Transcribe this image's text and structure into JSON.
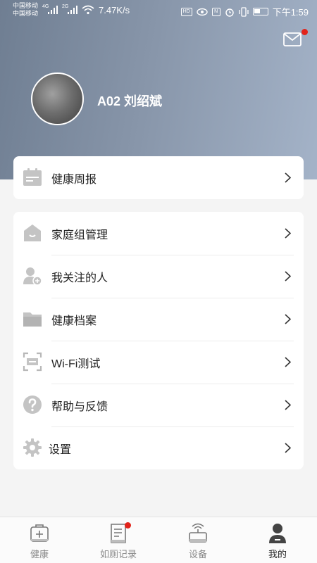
{
  "status_bar": {
    "carrier_1": "中国移动",
    "carrier_2": "中国移动",
    "net_1": "4G",
    "net_2": "2G",
    "speed": "7.47K/s",
    "hd_badge": "HD",
    "time": "下午1:59"
  },
  "profile": {
    "name": "A02 刘绍斌",
    "mail_icon": "mail-icon",
    "has_unread_mail": true
  },
  "weekly_card": {
    "items": [
      {
        "label": "健康周报",
        "icon": "report-icon"
      }
    ]
  },
  "menu": {
    "items": [
      {
        "label": "家庭组管理",
        "icon": "home-icon"
      },
      {
        "label": "我关注的人",
        "icon": "add-user-icon"
      },
      {
        "label": "健康档案",
        "icon": "folder-icon"
      },
      {
        "label": "Wi-Fi测试",
        "icon": "scan-icon"
      },
      {
        "label": "帮助与反馈",
        "icon": "help-icon"
      },
      {
        "label": "设置",
        "icon": "gear-icon"
      }
    ]
  },
  "tabbar": {
    "tabs": [
      {
        "label": "健康",
        "icon": "medical-box-icon",
        "active": false
      },
      {
        "label": "如厕记录",
        "icon": "record-icon",
        "active": false,
        "badge": true
      },
      {
        "label": "设备",
        "icon": "device-icon",
        "active": false
      },
      {
        "label": "我的",
        "icon": "person-icon",
        "active": true
      }
    ]
  },
  "colors": {
    "header_start": "#6f7e92",
    "header_end": "#a4b3c8",
    "icon_gray": "#c4c4c4",
    "badge_red": "#e2231a"
  }
}
